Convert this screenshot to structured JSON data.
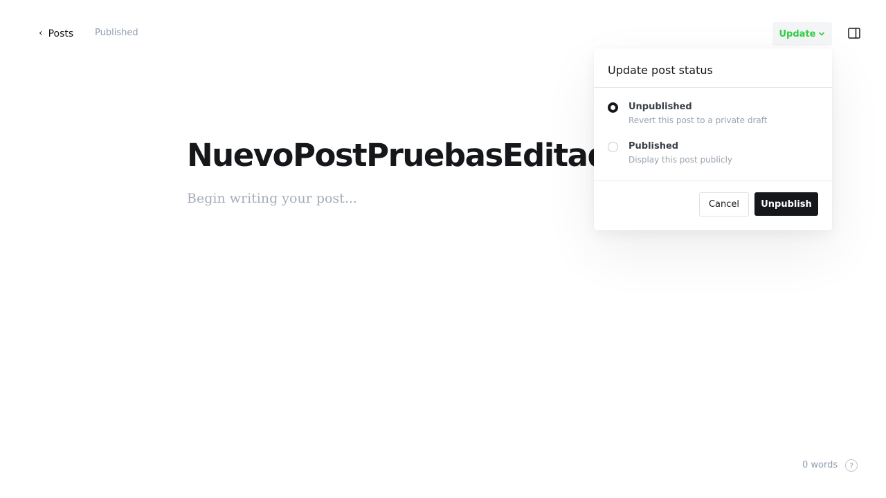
{
  "header": {
    "back_label": "Posts",
    "status": "Published",
    "update_label": "Update"
  },
  "editor": {
    "title": "NuevoPostPruebasEditado",
    "body_placeholder": "Begin writing your post..."
  },
  "popover": {
    "title": "Update post status",
    "options": [
      {
        "label": "Unpublished",
        "description": "Revert this post to a private draft",
        "selected": true
      },
      {
        "label": "Published",
        "description": "Display this post publicly",
        "selected": false
      }
    ],
    "cancel_label": "Cancel",
    "confirm_label": "Unpublish"
  },
  "footer": {
    "word_count": "0 words",
    "help_icon": "question-circle-icon",
    "help_symbol": "?"
  },
  "colors": {
    "accent_green": "#30cf43",
    "dark": "#15171a",
    "muted": "#8e9cac"
  }
}
